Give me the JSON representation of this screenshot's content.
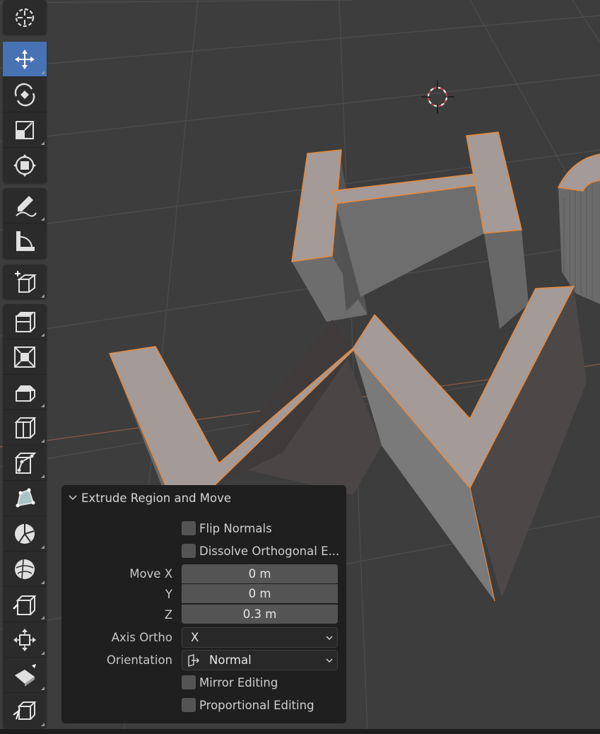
{
  "toolbar": {
    "tools": [
      {
        "name": "cursor-tool",
        "icon": "cursor-icon"
      },
      {
        "name": "move-tool",
        "icon": "move-icon",
        "active": true
      },
      {
        "name": "rotate-tool",
        "icon": "rotate-icon"
      },
      {
        "name": "scale-tool",
        "icon": "scale-icon"
      },
      {
        "name": "transform-tool",
        "icon": "transform-icon"
      },
      {
        "name": "annotate-tool",
        "icon": "annotate-icon"
      },
      {
        "name": "measure-tool",
        "icon": "measure-icon"
      },
      {
        "name": "add-cube-tool",
        "icon": "add-cube-icon"
      },
      {
        "name": "extrude-region-tool",
        "icon": "extrude-region-icon"
      },
      {
        "name": "inset-faces-tool",
        "icon": "inset-faces-icon"
      },
      {
        "name": "bevel-tool",
        "icon": "bevel-icon"
      },
      {
        "name": "loop-cut-tool",
        "icon": "loop-cut-icon"
      },
      {
        "name": "knife-tool",
        "icon": "knife-icon"
      },
      {
        "name": "poly-build-tool",
        "icon": "poly-build-icon"
      },
      {
        "name": "spin-tool",
        "icon": "spin-icon"
      },
      {
        "name": "smooth-tool",
        "icon": "smooth-icon"
      },
      {
        "name": "edge-slide-tool",
        "icon": "edge-slide-icon"
      },
      {
        "name": "shrink-fatten-tool",
        "icon": "shrink-fatten-icon"
      },
      {
        "name": "shear-tool",
        "icon": "shear-icon"
      },
      {
        "name": "rip-region-tool",
        "icon": "rip-region-icon"
      }
    ]
  },
  "panel": {
    "title": "Extrude Region and Move",
    "flip_normals": {
      "label": "Flip Normals",
      "checked": false
    },
    "dissolve_orthogonal": {
      "label": "Dissolve Orthogonal E...",
      "checked": false
    },
    "move": {
      "x_label": "Move X",
      "x_value": "0 m",
      "y_label": "Y",
      "y_value": "0 m",
      "z_label": "Z",
      "z_value": "0.3 m"
    },
    "axis_ortho": {
      "label": "Axis Ortho",
      "value": "X"
    },
    "orientation": {
      "label": "Orientation",
      "value": "Normal",
      "icon": "orientation-normal-icon"
    },
    "mirror_editing": {
      "label": "Mirror Editing",
      "checked": false
    },
    "proportional_editing": {
      "label": "Proportional Editing",
      "checked": false
    }
  },
  "colors": {
    "viewport_bg": "#3d3d3d",
    "active_tool": "#4772b3",
    "selection": "#e8893a",
    "panel_bg": "#1f1f1f"
  }
}
